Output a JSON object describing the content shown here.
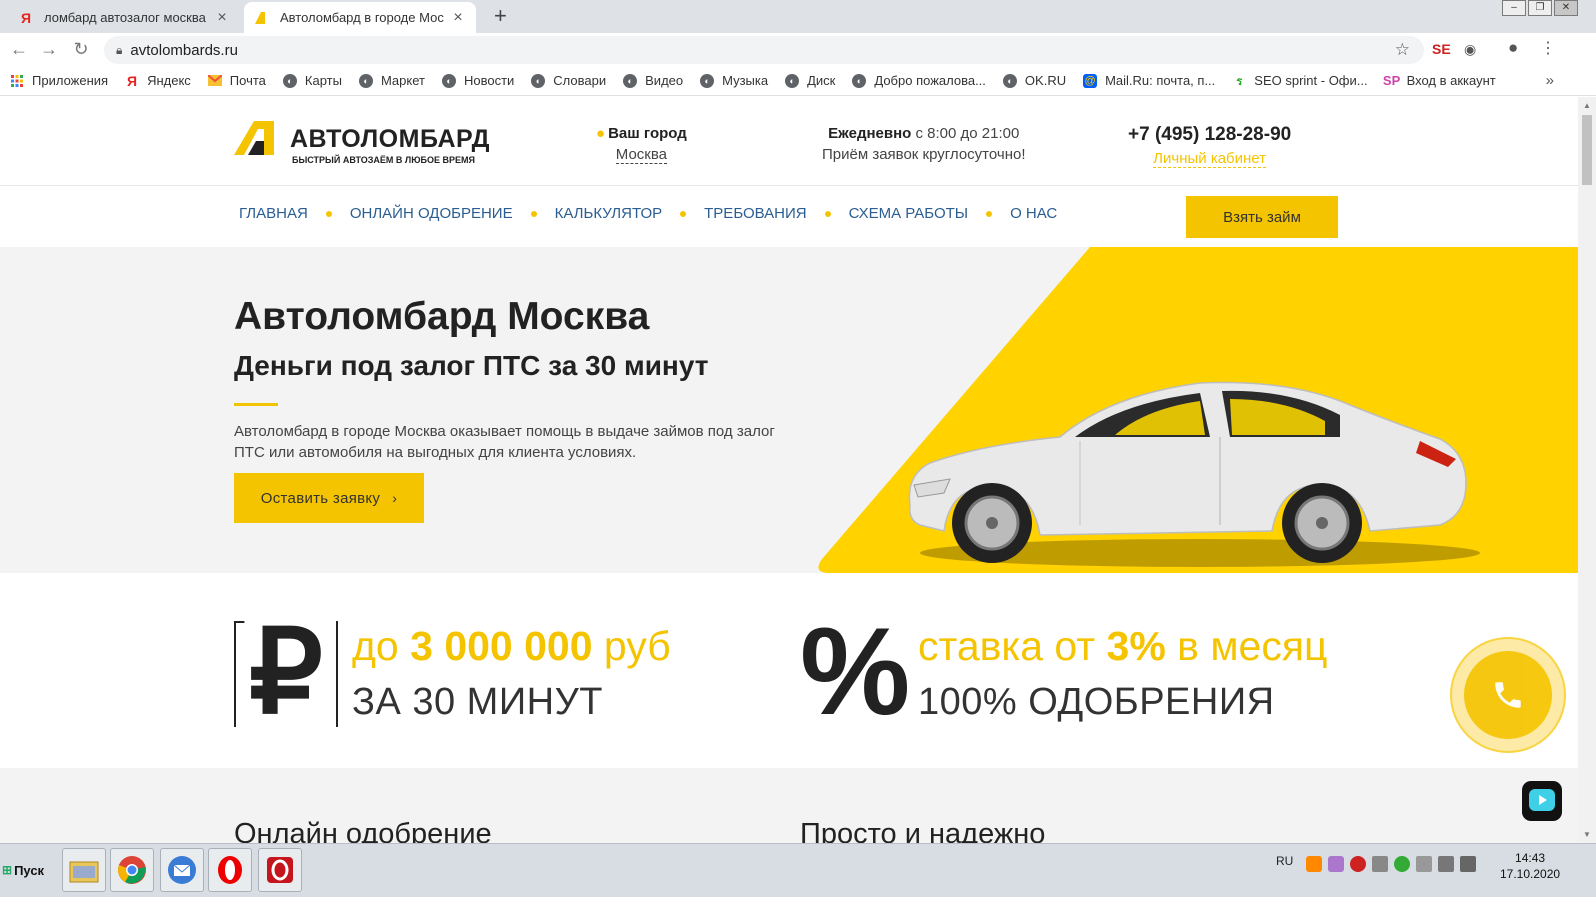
{
  "browser": {
    "tabs": [
      {
        "title": "ломбард автозалог москва – ",
        "active": false,
        "favicon": "Я"
      },
      {
        "title": "Автоломбард в городе Моск",
        "active": true
      }
    ],
    "url": "avtolombards.ru",
    "bookmarks": [
      {
        "label": "Приложения",
        "icon": "apps-grid-icon"
      },
      {
        "label": "Яндекс",
        "icon": "yandex-icon"
      },
      {
        "label": "Почта",
        "icon": "mail-icon"
      },
      {
        "label": "Карты",
        "icon": "globe-icon"
      },
      {
        "label": "Маркет",
        "icon": "globe-icon"
      },
      {
        "label": "Новости",
        "icon": "globe-icon"
      },
      {
        "label": "Словари",
        "icon": "globe-icon"
      },
      {
        "label": "Видео",
        "icon": "globe-icon"
      },
      {
        "label": "Музыка",
        "icon": "globe-icon"
      },
      {
        "label": "Диск",
        "icon": "globe-icon"
      },
      {
        "label": "Добро пожалова...",
        "icon": "globe-icon"
      },
      {
        "label": "OK.RU",
        "icon": "globe-icon"
      },
      {
        "label": "Mail.Ru: почта, п...",
        "icon": "mailru-icon"
      },
      {
        "label": "SEO sprint - Офи...",
        "icon": "seosprint-icon"
      },
      {
        "label": "Вход в аккаунт",
        "icon": "sp-icon"
      }
    ],
    "more_glyph": "»"
  },
  "site": {
    "logo": {
      "title": "АВТОЛОМБАРД",
      "subtitle": "БЫСТРЫЙ АВТОЗАЁМ В ЛЮБОЕ ВРЕМЯ"
    },
    "city": {
      "label": "Ваш город",
      "value": "Москва"
    },
    "hours": {
      "bold": "Ежедневно",
      "rest": " с 8:00 до 21:00",
      "note": "Приём заявок круглосуточно!"
    },
    "phone": {
      "number": "+7 (495) 128-28-90",
      "cabinet": "Личный кабинет"
    },
    "nav": [
      "ГЛАВНАЯ",
      "ОНЛАЙН ОДОБРЕНИЕ",
      "КАЛЬКУЛЯТОР",
      "ТРЕБОВАНИЯ",
      "СХЕМА РАБОТЫ",
      "О НАС"
    ],
    "cta_top": "Взять займ",
    "hero": {
      "title": "Автоломбард Москва",
      "subtitle": "Деньги под залог ПТС за 30 минут",
      "description": "Автоломбард в городе Москва оказывает помощь в выдаче займов под залог ПТС или автомобиля на выгодных для клиента условиях.",
      "button": "Оставить заявку",
      "button_chevron": "›"
    },
    "features": [
      {
        "symbol": "₽",
        "pre": "до ",
        "bold": "3 000 000",
        "post": " руб",
        "line2": "ЗА 30 МИНУТ"
      },
      {
        "symbol": "%",
        "pre": "ставка от ",
        "bold": "3%",
        "post": " в месяц",
        "line2": "100% ОДОБРЕНИЯ"
      }
    ],
    "sections": [
      "Онлайн одобрение",
      "Просто и надежно"
    ]
  },
  "taskbar": {
    "start": "Пуск",
    "apps": [
      "file-manager-icon",
      "chrome-icon",
      "mail-client-icon",
      "opera-icon",
      "opera-red-icon"
    ],
    "lang": "RU",
    "time": "14:43",
    "date": "17.10.2020"
  },
  "colors": {
    "brand_yellow": "#f5c400",
    "nav_blue": "#2a5d92",
    "dark": "#222222"
  }
}
